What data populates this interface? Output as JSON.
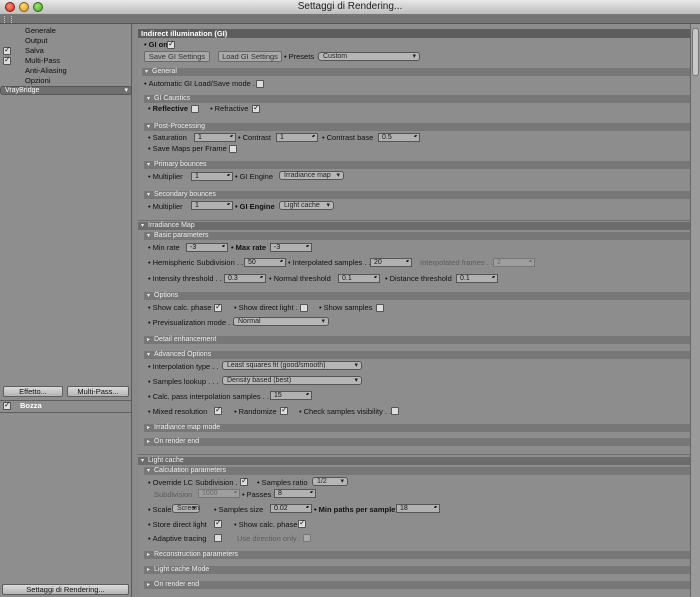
{
  "window": {
    "title": "Settaggi di Rendering..."
  },
  "sidebar": {
    "items": [
      {
        "label": "Generale",
        "checked": null
      },
      {
        "label": "Output",
        "checked": null
      },
      {
        "label": "Salva",
        "checked": true
      },
      {
        "label": "Multi-Pass",
        "checked": true
      },
      {
        "label": "Anti-Aliasing",
        "checked": null
      },
      {
        "label": "Opzioni",
        "checked": null
      },
      {
        "label": "VrayBridge",
        "checked": null
      }
    ],
    "effect_button": "Effetto...",
    "multipass_button": "Multi-Pass...",
    "preset_label": "Bozza",
    "bottom_button": "Settaggi di Rendering..."
  },
  "gi": {
    "section_title": "Indirect illumination (GI)",
    "gi_on_label": "GI on",
    "save_btn": "Save GI Settings",
    "load_btn": "Load GI Settings",
    "presets_label": "Presets",
    "presets_value": "Custom",
    "general": {
      "title": "General",
      "auto_load_label": "Automatic GI Load/Save mode . ."
    },
    "caustics": {
      "title": "GI Caustics",
      "reflective_label": "Reflective",
      "refractive_label": "Refractive"
    },
    "post": {
      "title": "Post-Processing",
      "saturation_label": "Saturation",
      "saturation": "1",
      "contrast_label": "Contrast",
      "contrast": "1",
      "contrast_base_label": "Contrast base",
      "contrast_base": "0.5",
      "save_maps_label": "Save Maps per Frame . ."
    },
    "primary": {
      "title": "Primary bounces",
      "multiplier_label": "Multiplier",
      "multiplier": "1",
      "engine_label": "GI Engine",
      "engine": "Irradiance map"
    },
    "secondary": {
      "title": "Secondary bounces",
      "multiplier_label": "Multiplier",
      "multiplier": "1",
      "engine_label": "GI Engine",
      "engine": "Light cache"
    }
  },
  "irradiance": {
    "section_title": "Irradiance Map",
    "basic": {
      "title": "Basic parameters",
      "min_rate_label": "Min rate",
      "min_rate": "-3",
      "max_rate_label": "Max rate",
      "max_rate": "-3",
      "hemi_label": "Hemispheric Subdivision . .",
      "hemi": "50",
      "interp_label": "Interpolated samples . .",
      "interp": "20",
      "interp_frames_label": "Interpolated frames . .",
      "interp_frames": "2",
      "intensity_label": "Intensity threshold . .",
      "intensity": "0.3",
      "normal_label": "Normal threshold",
      "normal": "0.1",
      "distance_label": "Distance threshold",
      "distance": "0.1"
    },
    "options": {
      "title": "Options",
      "show_phase_label": "Show calc. phase",
      "show_direct_label": "Show direct light . .",
      "show_samples_label": "Show samples",
      "preview_label": "Previsualization mode . .",
      "preview": "Normal"
    },
    "detail_title": "Detail enhancement",
    "advanced": {
      "title": "Advanced Options",
      "interp_type_label": "Interpolation type . .",
      "interp_type": "Least squares fit (good/smooth)",
      "lookup_label": "Samples lookup . . .",
      "lookup": "Density based (best)",
      "calc_pass_label": "Calc. pass interpolation samples . . .",
      "calc_pass": "15",
      "mixed_label": "Mixed resolution",
      "randomize_label": "Randomize",
      "check_vis_label": "Check samples visibility . ."
    },
    "mode_title": "Irradiance map mode",
    "on_render_end": "On render end"
  },
  "lightcache": {
    "section_title": "Light cache",
    "calc": {
      "title": "Calculation parameters",
      "override_label": "Override LC Subdivision . .",
      "ratio_label": "Samples ratio",
      "ratio": "1/2",
      "subdivision_label": "Subdivision",
      "subdivision": "1000",
      "passes_label": "Passes",
      "passes": "8",
      "scale_label": "Scale",
      "scale": "Screen",
      "sample_size_label": "Samples size",
      "sample_size": "0.02",
      "min_paths_label": "Min paths per sample",
      "min_paths": "18",
      "store_direct_label": "Store direct light",
      "show_phase_label": "Show calc. phase",
      "adaptive_label": "Adaptive tracing",
      "use_dir_label": "Use direction only . ."
    },
    "recon_title": "Reconstruction parameters",
    "mode_title": "Light cache Mode",
    "on_render_end": "On render end"
  }
}
